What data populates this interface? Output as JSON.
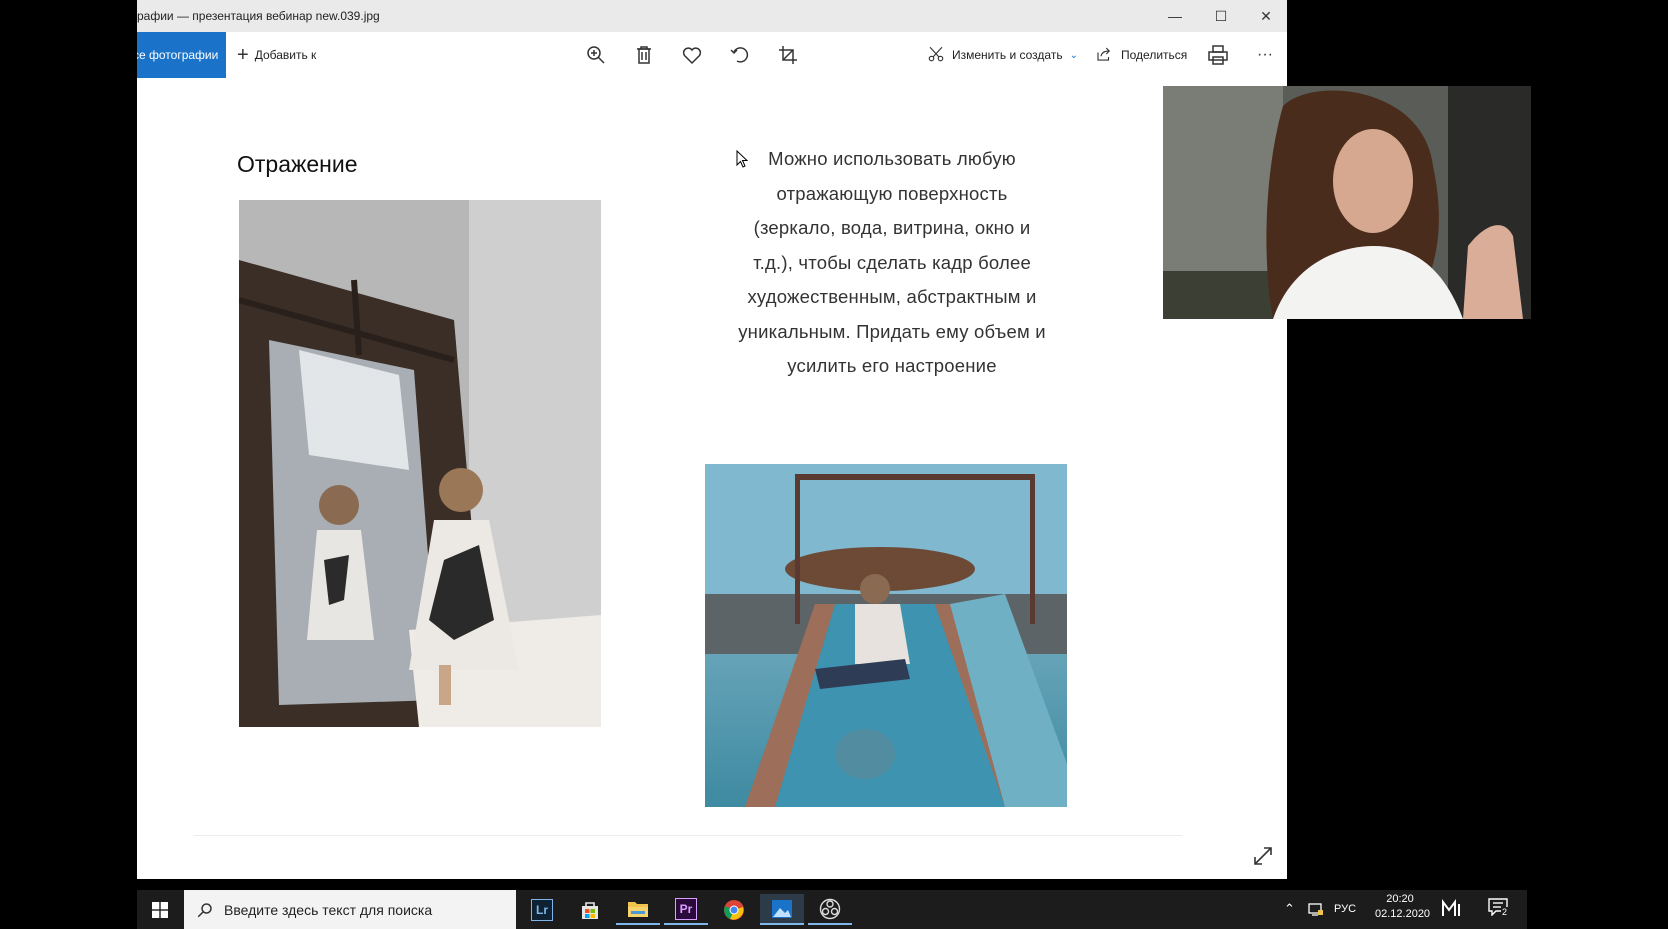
{
  "window": {
    "title": "рафии — презентация вебинар new.039.jpg",
    "minimize_glyph": "—",
    "maximize_glyph": "☐",
    "close_glyph": "✕"
  },
  "toolbar": {
    "all_photos_label": "се фотографии",
    "add_label": "Добавить к",
    "add_glyph": "+",
    "icons": [
      "zoom-in-icon",
      "delete-icon",
      "heart-icon",
      "rotate-icon",
      "crop-icon",
      "print-icon",
      "more-icon"
    ],
    "edit_label": "Изменить и создать",
    "edit_chevron": "⌄",
    "share_label": "Поделиться",
    "more_glyph": "···"
  },
  "slide": {
    "heading": "Отражение",
    "body_lines": [
      "Можно использовать любую",
      "отражающую поверхность",
      "(зеркало, вода, витрина, окно и",
      "т.д.), чтобы сделать кадр более",
      "художественным, абстрактным и",
      "уникальным. Придать ему объем и",
      "усилить его настроение"
    ]
  },
  "taskbar": {
    "search_placeholder": "Введите здесь текст для поиска",
    "apps": [
      "lightroom-icon",
      "store-icon",
      "file-explorer-icon",
      "premiere-icon",
      "chrome-icon",
      "photos-icon",
      "obs-icon"
    ],
    "lightroom_label": "Lr",
    "premiere_label": "Pr",
    "language": "РУС",
    "time": "20:20",
    "date": "02.12.2020",
    "notification_count": "2"
  },
  "colors": {
    "accent": "#1a73c9",
    "taskbar": "#1c1c1c",
    "titlebar": "#eaeaea"
  }
}
